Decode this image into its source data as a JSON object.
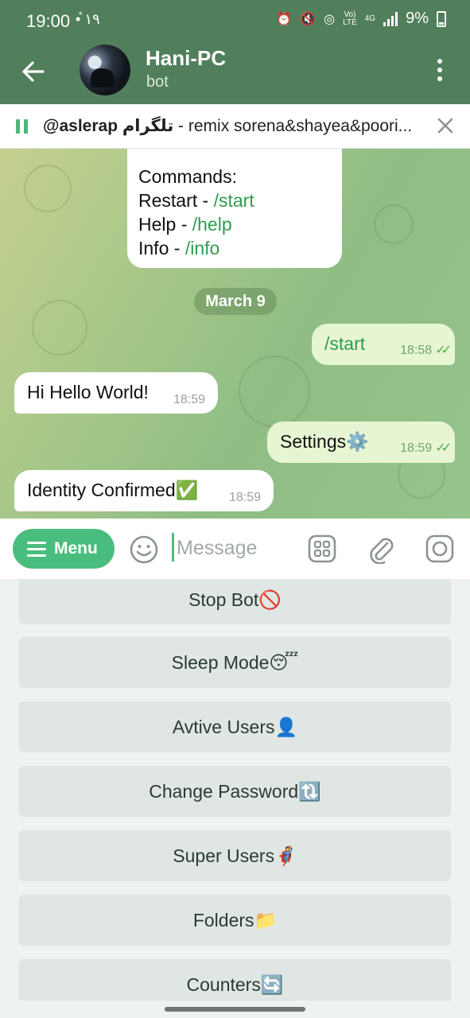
{
  "status_bar": {
    "time": "19:00",
    "notif": "•̊ ١٩",
    "network_small_top": "Vo)",
    "network_small_bottom": "LTE",
    "network_4g": "4G",
    "battery_percent": "9%"
  },
  "header": {
    "title": "Hani-PC",
    "subtitle": "bot"
  },
  "music_bar": {
    "author": "@aslerap تلگرام",
    "track": " - remix sorena&shayea&poori..."
  },
  "chat": {
    "commands_card": {
      "heading": "Commands:",
      "lines": [
        {
          "label": "Restart - ",
          "cmd": "/start"
        },
        {
          "label": "Help - ",
          "cmd": "/help"
        },
        {
          "label": "Info - ",
          "cmd": "/info"
        }
      ]
    },
    "date": "March 9",
    "messages": [
      {
        "direction": "out",
        "text": "/start",
        "time": "18:58"
      },
      {
        "direction": "in",
        "text": "Hi Hello World!",
        "time": "18:59"
      },
      {
        "direction": "out",
        "text": "Settings⚙️",
        "time": "18:59"
      },
      {
        "direction": "in",
        "text": "Identity Confirmed✅",
        "time": "18:59"
      }
    ]
  },
  "input": {
    "menu_label": "Menu",
    "placeholder": "Message",
    "icons": [
      "emoji-icon",
      "sticker-grid-icon",
      "attach-icon",
      "camera-icon"
    ]
  },
  "keyboard": {
    "buttons": [
      "Stop Bot🚫",
      "Sleep Mode😴",
      "Avtive Users👤",
      "Change Password🔃",
      "Super Users🦸",
      "Folders📁",
      "Counters🔄"
    ]
  },
  "colors": {
    "header_green": "#517f5c",
    "accent_green": "#49bd7d",
    "command_green": "#2e9c4f",
    "outgoing_bubble": "#e6f6d3"
  }
}
